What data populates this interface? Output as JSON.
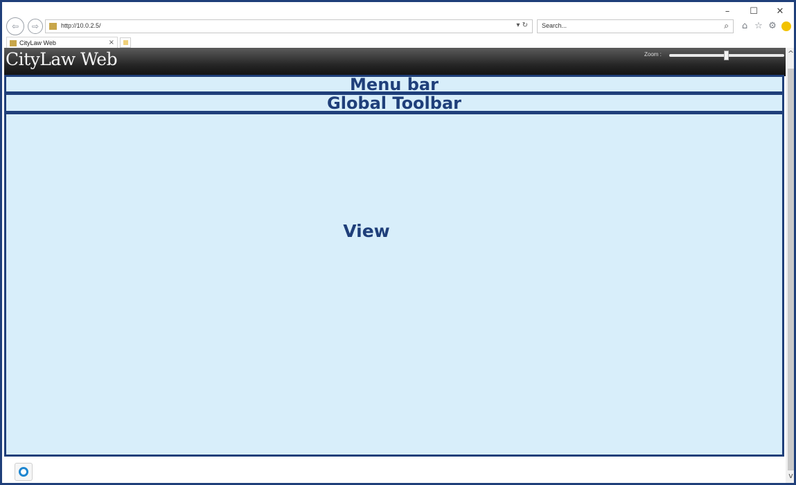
{
  "browser": {
    "address": "http://10.0.2.5/",
    "search_placeholder": "Search...",
    "tab_label": "CityLaw Web",
    "window_controls": {
      "minimize": "–",
      "maximize": "☐",
      "close": "✕"
    }
  },
  "app": {
    "title": "CityLaw Web",
    "zoom_label": "Zoom :",
    "zoom_level": 0.5
  },
  "regions": {
    "menu_bar": "Menu bar",
    "global_toolbar": "Global Toolbar",
    "view": "View"
  },
  "colors": {
    "annotation_border": "#1f3f7a",
    "annotation_fill": "#d8eefa"
  },
  "icons": [
    "back-arrow-icon",
    "forward-arrow-icon",
    "refresh-icon",
    "search-icon",
    "home-icon",
    "star-icon",
    "gear-icon",
    "smiley-icon",
    "new-tab-icon"
  ]
}
